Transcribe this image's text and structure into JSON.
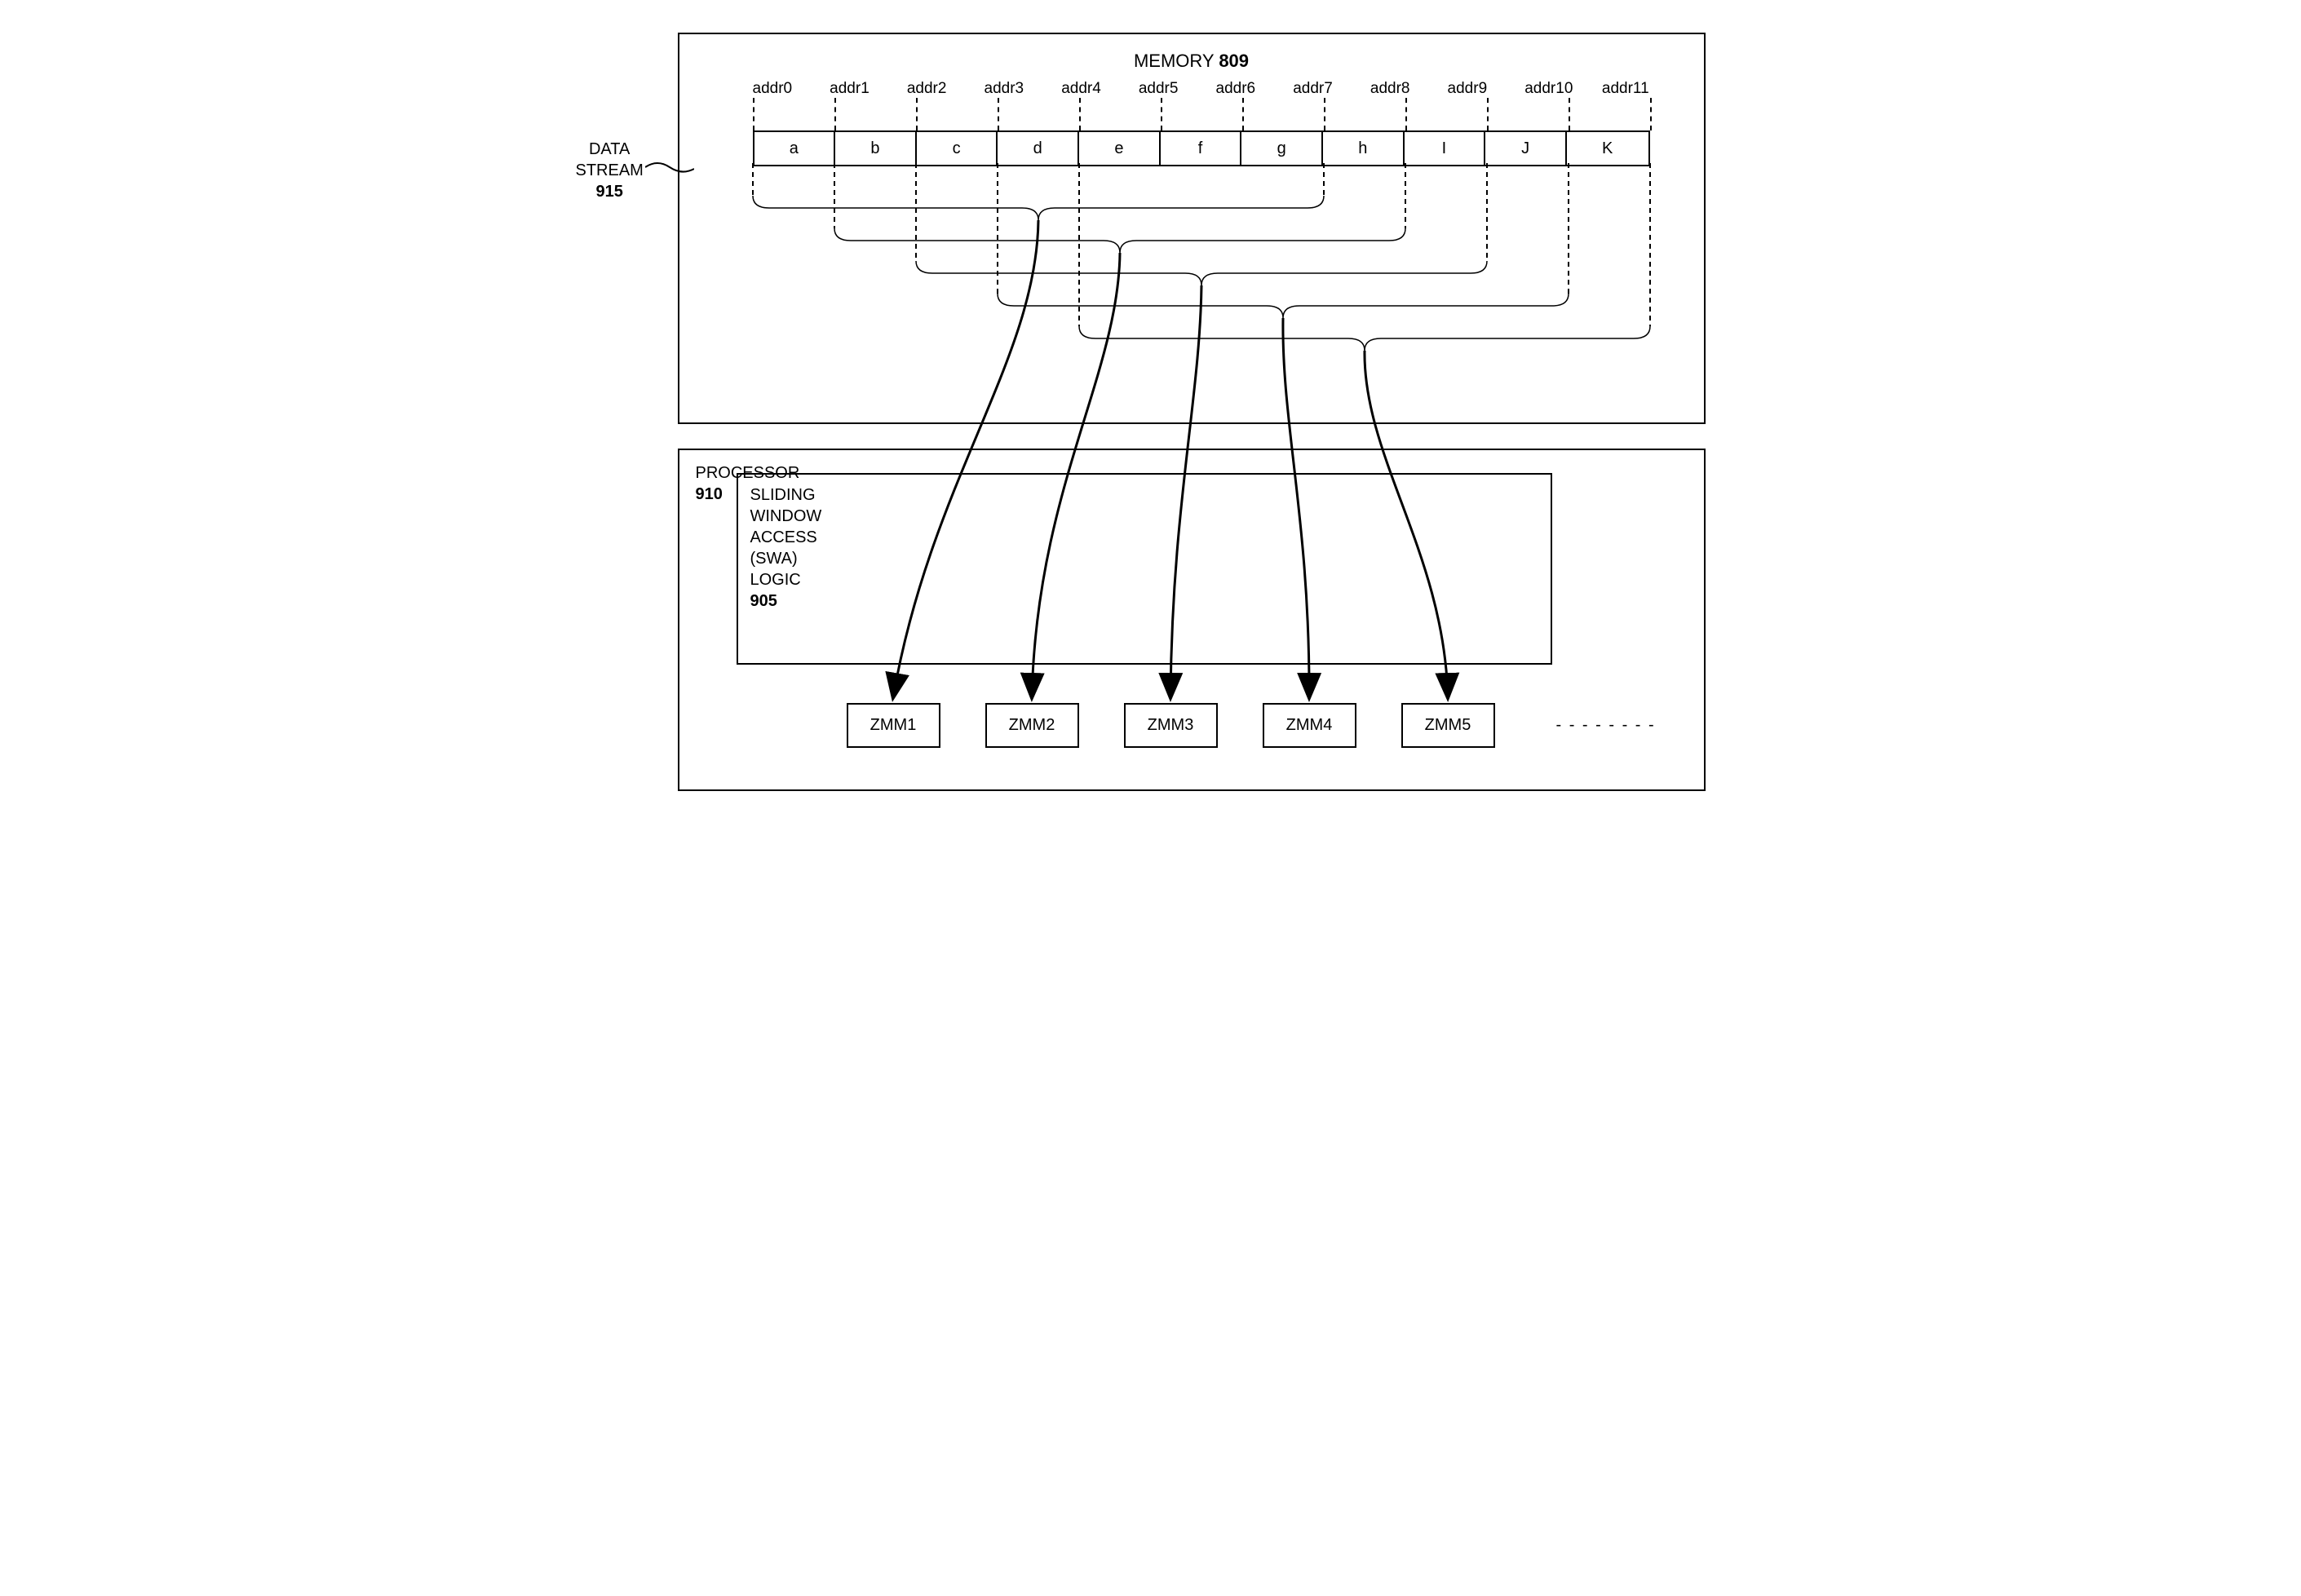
{
  "memory": {
    "title_text": "MEMORY",
    "title_num": "809",
    "addresses": [
      "addr0",
      "addr1",
      "addr2",
      "addr3",
      "addr4",
      "addr5",
      "addr6",
      "addr7",
      "addr8",
      "addr9",
      "addr10",
      "addr11"
    ],
    "cells": [
      "a",
      "b",
      "c",
      "d",
      "e",
      "f",
      "g",
      "h",
      "I",
      "J",
      "K"
    ]
  },
  "data_stream": {
    "line1": "DATA",
    "line2": "STREAM",
    "num": "915"
  },
  "processor": {
    "title_text": "PROCESSOR",
    "title_num": "910"
  },
  "swa": {
    "line1": "SLIDING",
    "line2": "WINDOW",
    "line3": "ACCESS",
    "line4": "(SWA)",
    "line5": "LOGIC",
    "num": "905"
  },
  "registers": [
    "ZMM1",
    "ZMM2",
    "ZMM3",
    "ZMM4",
    "ZMM5"
  ],
  "dashes": "- - - - - - - -",
  "brackets": [
    {
      "start": 0,
      "end": 7
    },
    {
      "start": 1,
      "end": 8
    },
    {
      "start": 2,
      "end": 9
    },
    {
      "start": 3,
      "end": 10
    },
    {
      "start": 4,
      "end": 11
    }
  ]
}
